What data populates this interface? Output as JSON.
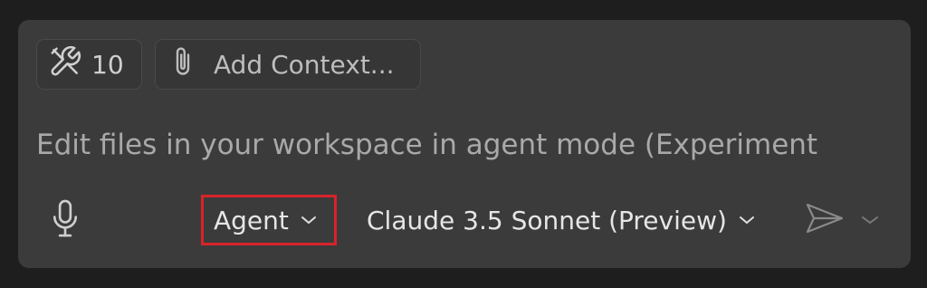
{
  "toolbar": {
    "tools_count": "10",
    "add_context_label": "Add Context..."
  },
  "input": {
    "placeholder": "Edit files in your workspace in agent mode (Experiment"
  },
  "footer": {
    "mode_label": "Agent",
    "model_label": "Claude 3.5 Sonnet (Preview)"
  },
  "icons": {
    "tools": "tools-icon",
    "attach": "paperclip-icon",
    "mic": "microphone-icon",
    "send": "send-icon",
    "chevron": "chevron-down-icon"
  },
  "colors": {
    "panel_bg": "#3b3b3b",
    "highlight_border": "#d8232a",
    "text_primary": "#e6e6e6",
    "placeholder_text": "#a9a9a9"
  }
}
